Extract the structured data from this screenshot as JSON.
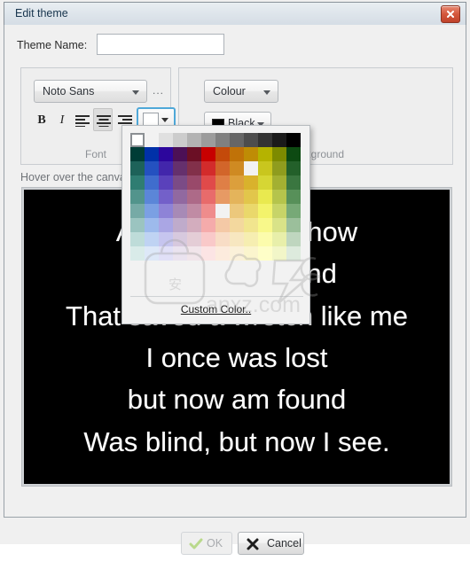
{
  "window": {
    "title": "Edit theme",
    "close_icon": "close-icon"
  },
  "theme_name": {
    "label": "Theme Name:",
    "value": "",
    "placeholder": ""
  },
  "font_group": {
    "caption": "Font",
    "font_combo": {
      "value": "Noto Sans",
      "caret_icon": "chevron-down-icon"
    },
    "more_button": "...",
    "bold_label": "B",
    "italic_label": "I",
    "align_left_icon": "align-left-icon",
    "align_center_icon": "align-center-icon",
    "align_right_icon": "align-right-icon",
    "color_button": {
      "swatch_color": "#ffffff",
      "caret_icon": "chevron-down-icon"
    }
  },
  "background_group": {
    "caption": "Background",
    "type_combo": {
      "value": "Colour",
      "caret_icon": "chevron-down-icon"
    },
    "color_combo": {
      "value": "Black",
      "swatch_color": "#000000",
      "caret_icon": "chevron-down-icon"
    }
  },
  "hint": "Hover over the canvas to see the background",
  "preview": {
    "background_color": "#000000",
    "text_color": "#ffffff",
    "lines": [
      "Amazing grace how",
      "sweet the sound",
      "That saved a wretch like me",
      "I once was lost",
      "but now am found",
      "Was blind, but now I see."
    ]
  },
  "footer": {
    "ok_label": "OK",
    "ok_icon": "check-icon",
    "ok_enabled": false,
    "cancel_label": "Cancel",
    "cancel_icon": "cross-icon"
  },
  "color_popup": {
    "custom_color_label": "Custom Color..",
    "selected_index": 0,
    "columns": 12,
    "colors": [
      "#ffffff",
      "#f2f2f2",
      "#e0e0e0",
      "#cccccc",
      "#b3b3b3",
      "#9c9c9c",
      "#808080",
      "#666666",
      "#4d4d4d",
      "#333333",
      "#1a1a1a",
      "#000000",
      "#003c36",
      "#0031a8",
      "#2c069c",
      "#4c1056",
      "#6b0f25",
      "#c70000",
      "#c44a0a",
      "#c07208",
      "#bf8c05",
      "#b5b300",
      "#7d8b00",
      "#0d4a12",
      "#1d6259",
      "#2451c0",
      "#4226ab",
      "#65306d",
      "#82304a",
      "#d32b2b",
      "#d2652a",
      "#cf8a22",
      "#ccа000",
      "#c9c61e",
      "#8f9c1e",
      "#23602a",
      "#2f7d72",
      "#3f6dcd",
      "#5a41bb",
      "#7b4b86",
      "#99496a",
      "#e04a4a",
      "#df7f46",
      "#dc9f3c",
      "#d9b22c",
      "#d6d634",
      "#a3b032",
      "#3a7640",
      "#52948c",
      "#5b86d8",
      "#7360c9",
      "#9169a0",
      "#ad6a88",
      "#e86b6b",
      "#e79a64",
      "#e4b45b",
      "#e2c64b",
      "#e9e94f",
      "#b5c44c",
      "#579059",
      "#76aaa6",
      "#7ba0e3",
      "#8e83d7",
      "#a78ab6",
      "#c08ba4",
      "#ef8c8c",
      "#ee b285",
      "#ecc87c",
      "#ead86b",
      "#f3f36b",
      "#c7d468",
      "#77a977",
      "#9bc4c0",
      "#9dbaec",
      "#aaa6e4",
      "#bfabcb",
      "#d3adbe",
      "#f5abab",
      "#f4c9a6",
      "#f3d89e",
      "#f1e58e",
      "#f8f88a",
      "#d9e388",
      "#9bbf9b",
      "#bedcd9",
      "#bfd3f3",
      "#c6c5ef",
      "#d7c9de",
      "#e4cdd6",
      "#f9c9c9",
      "#f8ddc6",
      "#f7e7c0",
      "#f6eeb1",
      "#fcfcac",
      "#e8efaa",
      "#bfd6bf",
      "#d9ebe9",
      "#dde8f8",
      "#e1e0f7",
      "#eae3ef",
      "#f1e5ea",
      "#fce4e4",
      "#fcebdd",
      "#fbf1d9",
      "#fbf5cd",
      "#fefec8",
      "#f2f6c8",
      "#ddeadd"
    ]
  },
  "watermark": {
    "text": "anxz.com"
  }
}
